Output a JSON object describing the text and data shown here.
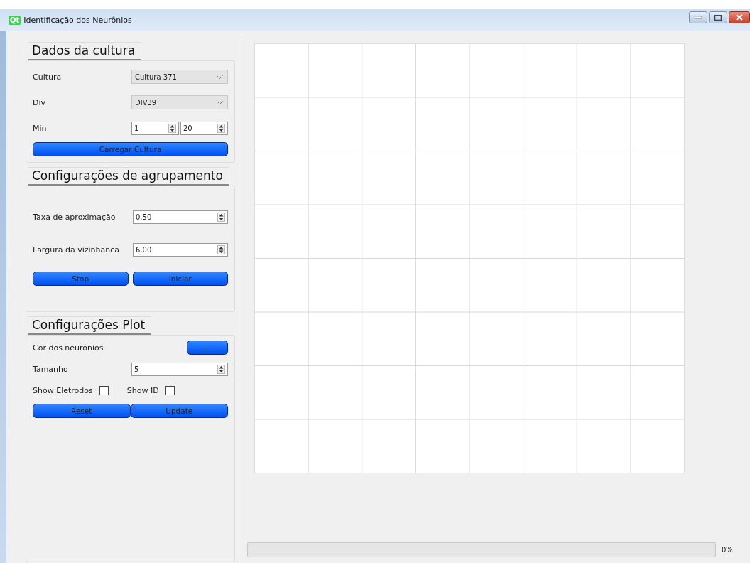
{
  "window": {
    "logo": "Qt",
    "title": "Identificação dos Neurônios"
  },
  "groups": [
    {
      "title": "Dados da cultura",
      "rows": [
        {
          "kind": "combo",
          "label": "Cultura",
          "value": "Cultura 371"
        },
        {
          "kind": "combo",
          "label": "Div",
          "value": "DIV39"
        },
        {
          "kind": "range",
          "label": "Min",
          "values": [
            "1",
            "20"
          ]
        }
      ],
      "buttons": [
        "Carregar Cultura"
      ]
    },
    {
      "title": "Configurações de agrupamento",
      "rows": [
        {
          "kind": "spin",
          "label": "Taxa de aproximação",
          "value": "0,50"
        },
        {
          "kind": "spin",
          "label": "Largura da vizinhanca",
          "value": "6,00"
        }
      ],
      "buttons": [
        "Stop",
        "Iniciar"
      ]
    },
    {
      "title": "Configurações Plot",
      "rows": [
        {
          "kind": "color",
          "label": "Cor dos neurônios",
          "button": "..."
        },
        {
          "kind": "spin",
          "label": "Tamanho",
          "value": "5"
        },
        {
          "kind": "checks",
          "items": [
            {
              "label": "Show Eletrodos",
              "checked": false
            },
            {
              "label": "Show ID",
              "checked": false
            }
          ]
        }
      ],
      "buttons": [
        "Reset",
        "Update"
      ]
    }
  ],
  "progress": {
    "level": 0,
    "text": "0%"
  }
}
